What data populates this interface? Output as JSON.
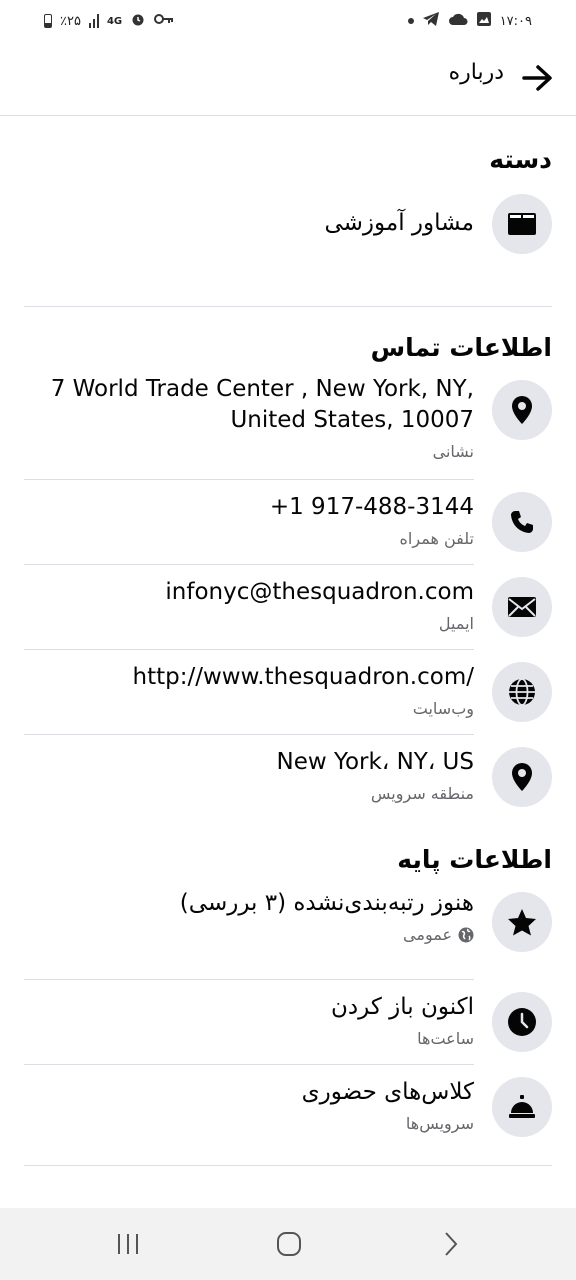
{
  "status_bar": {
    "time": "۱۷:۰۹",
    "battery": "٪۲۵",
    "network": "4G"
  },
  "header": {
    "title": "درباره",
    "back_icon": "arrow-right-icon"
  },
  "category": {
    "title": "دسته",
    "value": "مشاور آموزشی",
    "icon": "book-icon"
  },
  "contact": {
    "title": "اطلاعات تماس",
    "items": [
      {
        "value": "7 World Trade Center , New York, NY, United States, 10007",
        "label": "نشانی",
        "icon": "location-pin-icon"
      },
      {
        "value": "+1 917-488-3144",
        "label": "تلفن همراه",
        "icon": "phone-icon"
      },
      {
        "value": "infonyc@thesquadron.com",
        "label": "ایمیل",
        "icon": "envelope-icon"
      },
      {
        "value": "http://www.thesquadron.com/",
        "label": "وب‌سایت",
        "icon": "globe-icon"
      },
      {
        "value": "New York، NY، US",
        "label": "منطقه سرویس",
        "icon": "location-pin-icon"
      }
    ]
  },
  "basic": {
    "title": "اطلاعات پایه",
    "items": [
      {
        "value": "هنوز رتبه‌بندی‌نشده (۳ بررسی)",
        "label": "عمومی",
        "icon": "star-icon"
      },
      {
        "value": "اکنون باز کردن",
        "label": "ساعت‌ها",
        "icon": "clock-icon"
      },
      {
        "value": "کلاس‌های حضوری",
        "label": "سرویس‌ها",
        "icon": "service-bell-icon"
      }
    ]
  },
  "colors": {
    "icon_bg": "#e4e6eb",
    "secondary_text": "#65676b",
    "divider": "#dadde1"
  }
}
